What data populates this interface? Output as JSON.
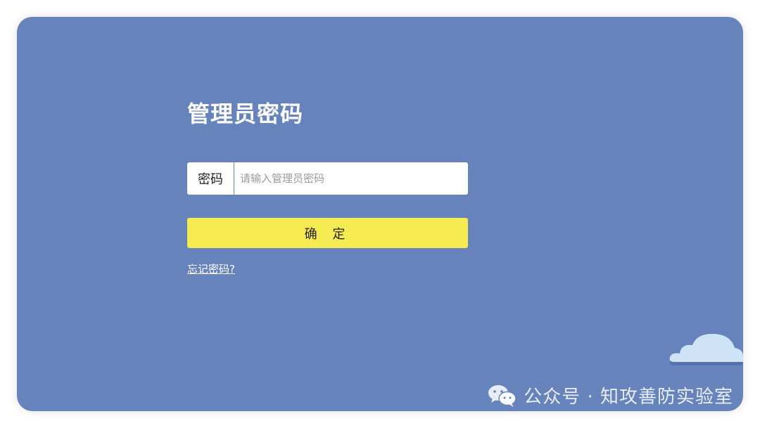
{
  "login": {
    "title": "管理员密码",
    "password_label": "密码",
    "password_placeholder": "请输入管理员密码",
    "password_value": "",
    "confirm_label": "确 定",
    "forgot_link": "忘记密码?"
  },
  "watermark": {
    "text": "公众号 · 知攻善防实验室",
    "icon": "wechat-icon"
  },
  "decoration": {
    "cloud_icon": "cloud-icon"
  },
  "colors": {
    "background": "#6683bc",
    "confirm_button": "#f6ea52",
    "text_white": "#ffffff"
  }
}
